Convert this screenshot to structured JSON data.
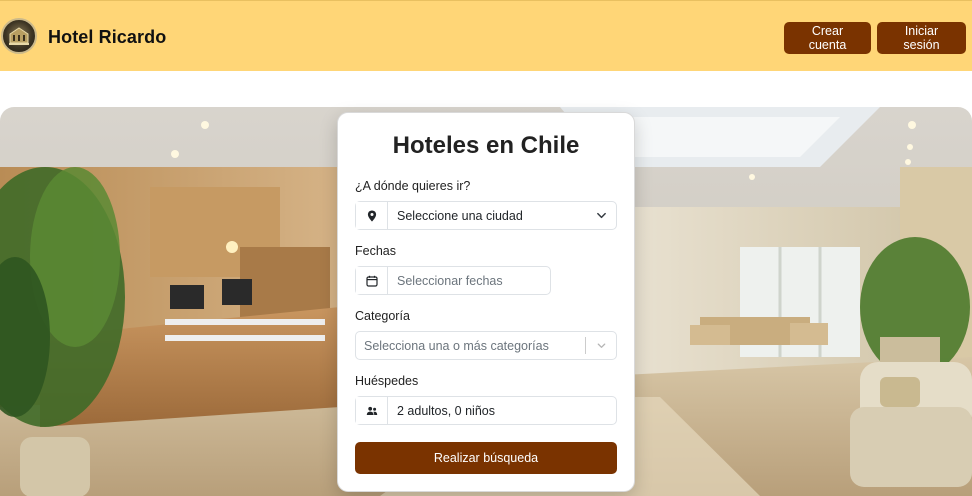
{
  "header": {
    "brand": "Hotel Ricardo",
    "register_label": "Crear cuenta",
    "login_label": "Iniciar sesión"
  },
  "search": {
    "title": "Hoteles en Chile",
    "destination": {
      "label": "¿A dónde quieres ir?",
      "value": "Seleccione una ciudad",
      "icon": "map-pin-icon"
    },
    "dates": {
      "label": "Fechas",
      "placeholder": "Seleccionar fechas",
      "icon": "calendar-icon"
    },
    "category": {
      "label": "Categoría",
      "placeholder": "Selecciona una o más categorías"
    },
    "guests": {
      "label": "Huéspedes",
      "value": "2 adultos, 0 niños",
      "icon": "users-icon"
    },
    "submit_label": "Realizar búsqueda"
  },
  "colors": {
    "header_bg": "#ffd677",
    "primary": "#7a3300"
  }
}
